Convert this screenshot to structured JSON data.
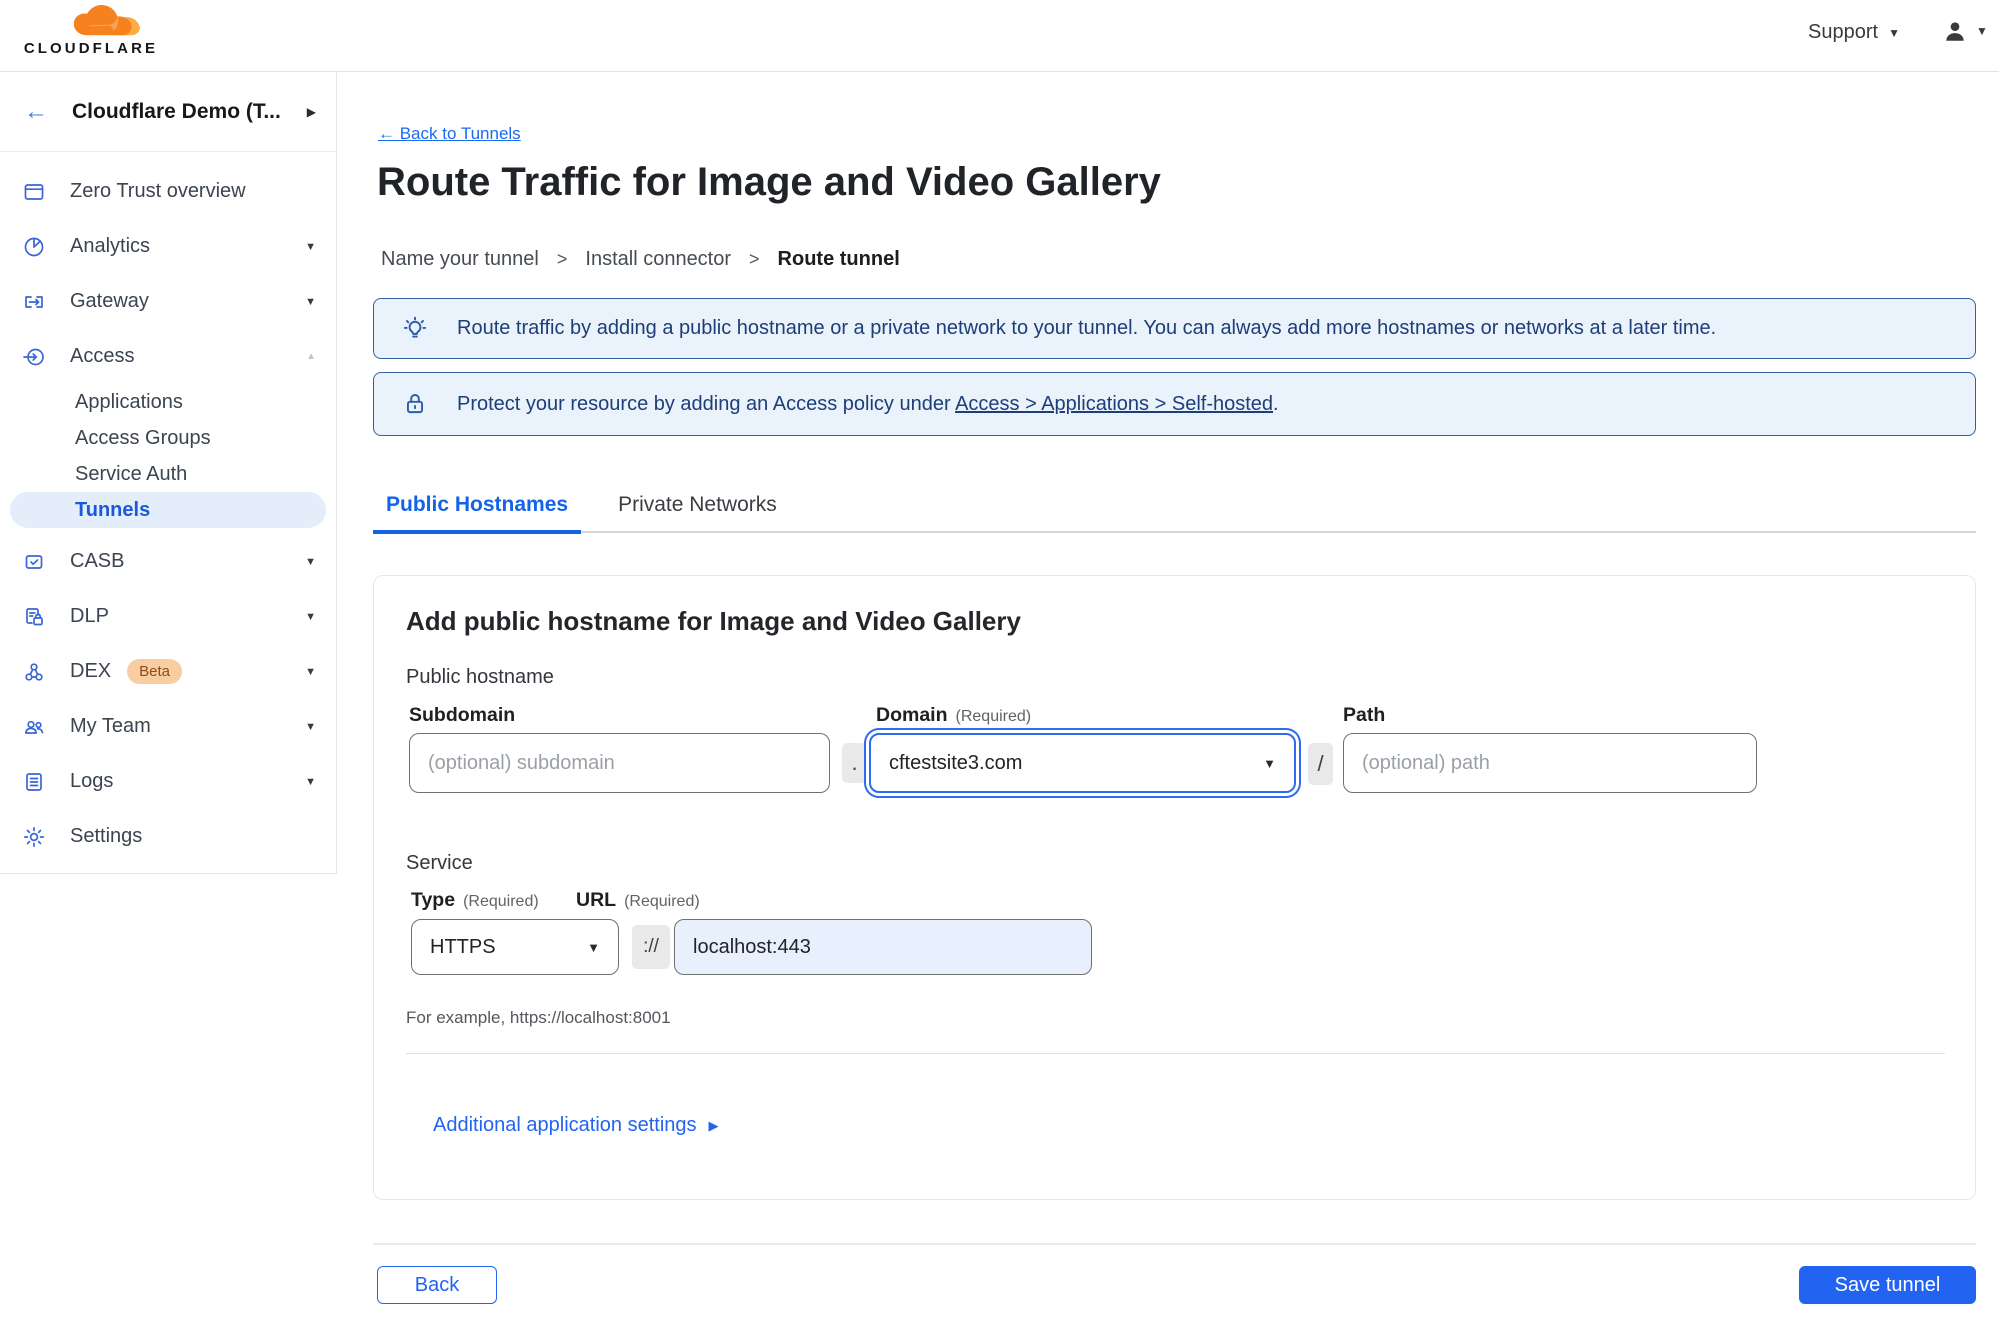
{
  "topbar": {
    "brand": "CLOUDFLARE",
    "support_label": "Support"
  },
  "sidebar": {
    "account_label": "Cloudflare Demo (T...",
    "items": [
      {
        "label": "Zero Trust overview"
      },
      {
        "label": "Analytics"
      },
      {
        "label": "Gateway"
      },
      {
        "label": "Access"
      },
      {
        "label": "CASB"
      },
      {
        "label": "DLP"
      },
      {
        "label": "DEX",
        "badge": "Beta"
      },
      {
        "label": "My Team"
      },
      {
        "label": "Logs"
      },
      {
        "label": "Settings"
      }
    ],
    "access_subitems": [
      {
        "label": "Applications"
      },
      {
        "label": "Access Groups"
      },
      {
        "label": "Service Auth"
      },
      {
        "label": "Tunnels",
        "active": true
      }
    ]
  },
  "page": {
    "back_link": "← Back to Tunnels",
    "title": "Route Traffic for Image and Video Gallery",
    "steps": [
      "Name your tunnel",
      "Install connector",
      "Route tunnel"
    ],
    "step_separator": ">",
    "banners": [
      {
        "text": "Route traffic by adding a public hostname or a private network to your tunnel. You can always add more hostnames or networks at a later time."
      },
      {
        "prefix": "Protect your resource by adding an Access policy under ",
        "link_text": "Access > Applications > Self-hosted",
        "suffix": "."
      }
    ],
    "tabs": [
      {
        "label": "Public Hostnames",
        "active": true
      },
      {
        "label": "Private Networks",
        "active": false
      }
    ],
    "card": {
      "heading": "Add public hostname for Image and Video Gallery",
      "hostname_section": "Public hostname",
      "subdomain_label": "Subdomain",
      "subdomain_placeholder": "(optional) subdomain",
      "domain_label": "Domain",
      "required_label": "(Required)",
      "domain_value": "cftestsite3.com",
      "dot_separator": ".",
      "slash_separator": "/",
      "path_label": "Path",
      "path_placeholder": "(optional) path",
      "service_section": "Service",
      "type_label": "Type",
      "type_value": "HTTPS",
      "scheme_separator": "://",
      "url_label": "URL",
      "url_value": "localhost:443",
      "example": "For example, https://localhost:8001",
      "additional_settings": "Additional application settings"
    },
    "back_button": "Back",
    "save_button": "Save tunnel"
  },
  "colors": {
    "accent_blue": "#2264f1",
    "active_tab_blue": "#1363e6",
    "banner_bg": "#eaf2fb",
    "banner_border": "#35619f",
    "banner_text": "#1d3e77",
    "sidebar_icon_blue": "#3a66d5",
    "active_pill_bg": "#e4eefb",
    "beta_badge_bg": "#f7cda1",
    "beta_badge_text": "#8f4d16",
    "url_field_bg": "#e8f0fd",
    "logo_orange": "#f6821f",
    "logo_orange_light": "#fbad41"
  }
}
